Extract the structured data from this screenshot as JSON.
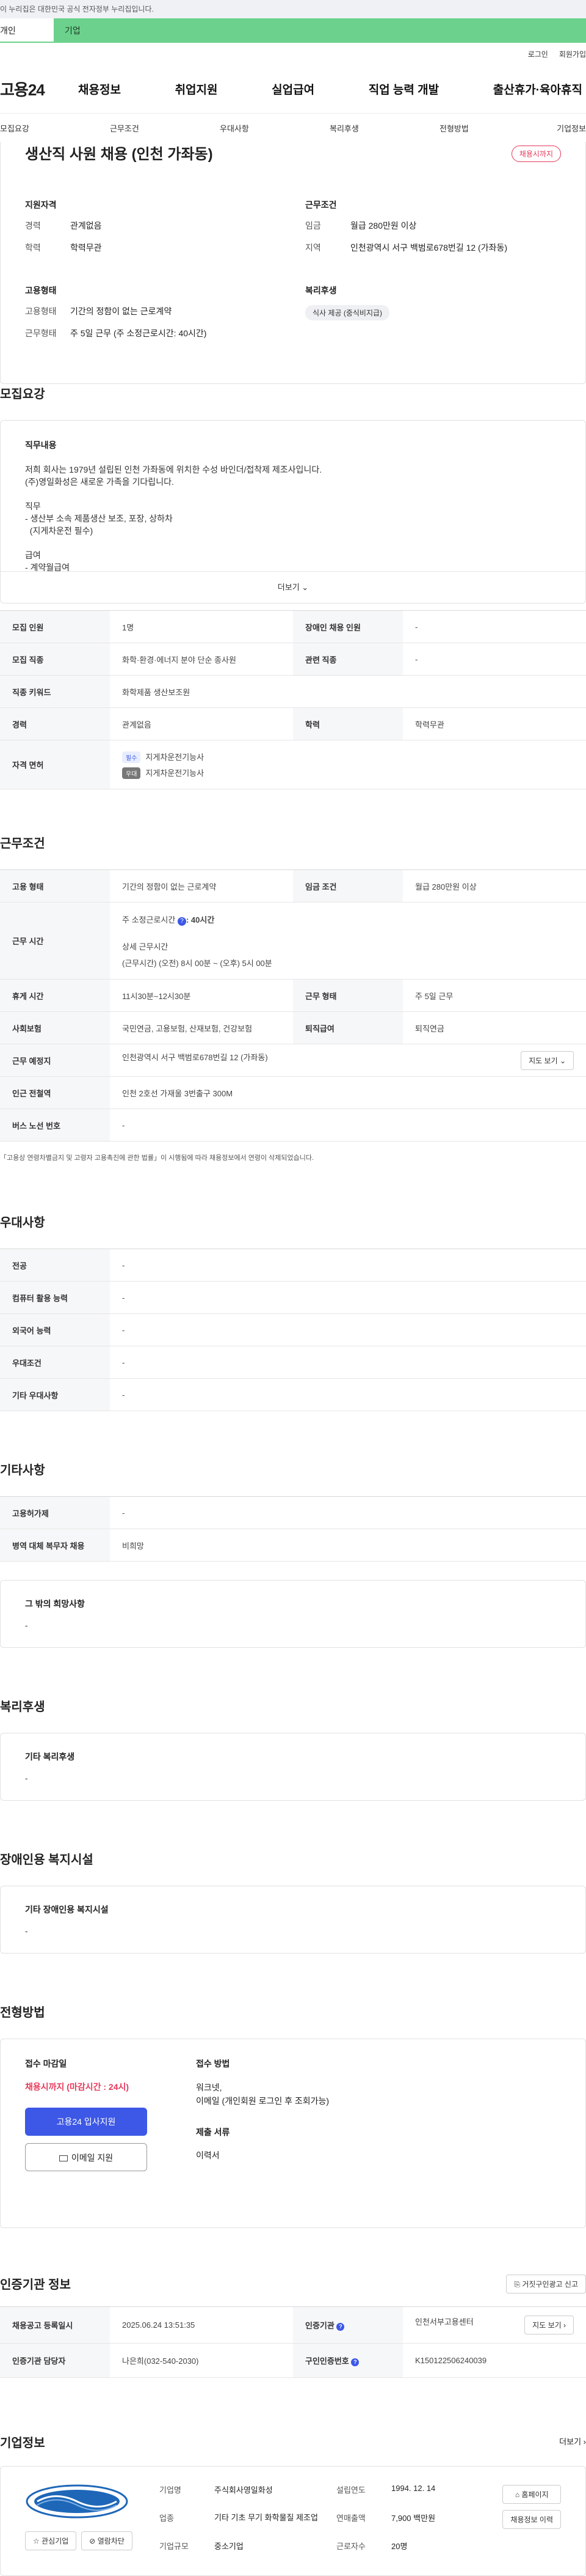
{
  "banner": {
    "text": "이 누리집은 대한민국 공식 전자정부 누리집입니다."
  },
  "tabs": {
    "personal": "개인",
    "company": "기업"
  },
  "util": {
    "login": "로그인",
    "signup": "회원가입"
  },
  "logo": "고용24",
  "gnb": [
    "채용정보",
    "취업지원",
    "실업급여",
    "직업 능력 개발",
    "출산휴가·육아휴직"
  ],
  "anchors": [
    "모집요강",
    "근무조건",
    "우대사항",
    "복리후생",
    "전형방법",
    "기업정보"
  ],
  "summary": {
    "title": "생산직 사원 채용 (인천 가좌동)",
    "status": "채용시까지",
    "qual_title": "지원자격",
    "qual": [
      {
        "k": "경력",
        "v": "관계없음"
      },
      {
        "k": "학력",
        "v": "학력무관"
      }
    ],
    "work_title": "근무조건",
    "work": [
      {
        "k": "임금",
        "v": "월급 280만원 이상"
      },
      {
        "k": "지역",
        "v": "인천광역시 서구 백범로678번길 12 (가좌동)"
      }
    ],
    "emp_title": "고용형태",
    "emp": [
      {
        "k": "고용형태",
        "v": "기간의 정함이 없는 근로계약"
      },
      {
        "k": "근무형태",
        "v": "주 5일 근무 (주 소정근로시간: 40시간)"
      }
    ],
    "welfare_title": "복리후생",
    "welfare_chip": "식사 제공 (중식비지급)"
  },
  "recruit": {
    "title": "모집요강",
    "job_content_label": "직무내용",
    "job_lines": [
      "저희 회사는 1979년 설립된 인천 가좌동에 위치한 수성 바인더/접착제 제조사입니다.",
      "(주)영일화성은 새로운 가족을 기다립니다.",
      "",
      "직무",
      "- 생산부 소속 제품생산 보조, 포장, 상하차",
      "  (지게차운전 필수)",
      "",
      "급여",
      "- 계약월급여"
    ],
    "more": "더보기",
    "rows": [
      {
        "h1": "모집 인원",
        "v1": "1명",
        "h2": "장애인 채용 인원",
        "v2": "-"
      },
      {
        "h1": "모집 직종",
        "v1": "화학·환경·에너지 분야 단순 종사원",
        "h2": "관련 직종",
        "v2": "-"
      },
      {
        "h1": "직종 키워드",
        "v1": "화학제품 생산보조원"
      },
      {
        "h1": "경력",
        "v1": "관계없음",
        "h2": "학력",
        "v2": "학력무관"
      }
    ],
    "license_h": "자격 면허",
    "license": [
      {
        "tag": "필수",
        "name": "지게차운전기능사"
      },
      {
        "tag": "우대",
        "name": "지게차운전기능사"
      }
    ]
  },
  "conditions": {
    "title": "근무조건",
    "emp_type_h": "고용 형태",
    "emp_type_v": "기간의 정함이 없는 근로계약",
    "wage_h": "임금 조건",
    "wage_v": "월급 280만원 이상",
    "time_h": "근무 시간",
    "time_week": "주 소정근로시간",
    "time_week_v": ": 40시간",
    "time_detail_label": "상세 근무시간",
    "time_detail": "(근무시간) (오전) 8시 00분 ~ (오후) 5시 00분",
    "break_h": "휴게 시간",
    "break_v": "11시30분~12시30분",
    "form_h": "근무 형태",
    "form_v": "주 5일 근무",
    "ins_h": "사회보험",
    "ins_v": "국민연금, 고용보험, 산재보험, 건강보험",
    "retire_h": "퇴직급여",
    "retire_v": "퇴직연금",
    "place_h": "근무 예정지",
    "place_v": "인천광역시 서구 백범로678번길 12 (가좌동)",
    "map_btn": "지도 보기",
    "subway_h": "인근 전철역",
    "subway_v": "인천 2호선 가재울 3번출구 300M",
    "bus_h": "버스 노선 번호",
    "bus_v": "-",
    "note": "「고용상 연령차별금지 및 고령자 고용촉진에 관한 법률」이 시행됨에 따라 채용정보에서 연령이 삭제되었습니다."
  },
  "preference": {
    "title": "우대사항",
    "rows": [
      {
        "h": "전공",
        "v": "-"
      },
      {
        "h": "컴퓨터 활용 능력",
        "v": "-"
      },
      {
        "h": "외국어 능력",
        "v": "-"
      },
      {
        "h": "우대조건",
        "v": "-"
      },
      {
        "h": "기타 우대사항",
        "v": "-"
      }
    ]
  },
  "etc": {
    "title": "기타사항",
    "rows": [
      {
        "h": "고용허가제",
        "v": "-"
      },
      {
        "h": "병역 대체 복무자 채용",
        "v": "비희망"
      }
    ],
    "other_label": "그 밖의 희망사항",
    "other_value": "-"
  },
  "welfare": {
    "title": "복리후생",
    "label": "기타 복리후생",
    "value": "-"
  },
  "disability": {
    "title": "장애인용 복지시설",
    "label": "기타 장애인용 복지시설",
    "value": "-"
  },
  "apply": {
    "title": "전형방법",
    "deadline_label": "접수 마감일",
    "deadline_value": "채용시까지 (마감시간 : 24시)",
    "btn_apply": "고용24 입사지원",
    "btn_email": "이메일 지원",
    "method_label": "접수 방법",
    "method_lines": [
      "워크넷,",
      "이메일 (개인회원 로그인 후 조회가능)"
    ],
    "docs_label": "제출 서류",
    "docs_value": "이력서"
  },
  "agency": {
    "title": "인증기관 정보",
    "report_btn": "거짓구인광고 신고",
    "rows": [
      {
        "h1": "채용공고 등록일시",
        "v1": "2025.06.24 13:51:35",
        "h2": "인증기관",
        "v2": "인천서부고용센터",
        "btn": "지도 보기"
      },
      {
        "h1": "인증기관 담당자",
        "v1": "나은희(032-540-2030)",
        "h2": "구인인증번호",
        "v2": "K150122506240039"
      }
    ]
  },
  "company": {
    "title": "기업정보",
    "more": "더보기",
    "logo_text": "YOUNG IL CHEMICAL CO.,LTD",
    "interest_btn": "관심기업",
    "block_btn": "열람차단",
    "fields": [
      {
        "k": "기업명",
        "v": "주식회사영일화성"
      },
      {
        "k": "설립연도",
        "v": "1994. 12. 14"
      },
      {
        "k": "업종",
        "v": "기타 기초 무기 화학물질 제조업"
      },
      {
        "k": "연매출액",
        "v": "7,900 백만원"
      },
      {
        "k": "기업규모",
        "v": "중소기업"
      },
      {
        "k": "근로자수",
        "v": "20명"
      }
    ],
    "homepage_btn": "홈페이지",
    "jobs_btn": "채용정보 이력"
  },
  "colors": {
    "accent": "#3d58e6",
    "danger": "#e6395b",
    "green": "#6bd18c"
  }
}
